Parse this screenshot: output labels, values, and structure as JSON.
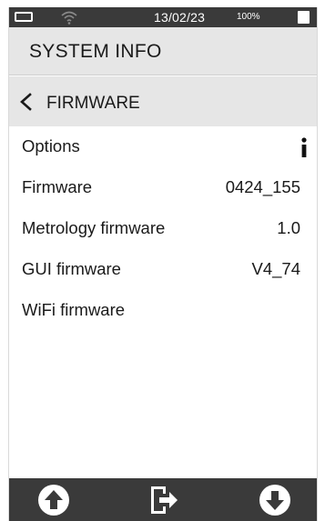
{
  "status_bar": {
    "date": "13/02/23",
    "battery_percent": "100%",
    "icons": [
      "battery-icon",
      "wifi-icon",
      "battery-full-icon"
    ]
  },
  "header": {
    "title": "SYSTEM INFO"
  },
  "subheader": {
    "back_icon": "chevron-left-icon",
    "title": "FIRMWARE"
  },
  "rows": [
    {
      "label": "Options",
      "value": "",
      "icon": "info-icon"
    },
    {
      "label": "Firmware",
      "value": "0424_155"
    },
    {
      "label": "Metrology firmware",
      "value": "1.0"
    },
    {
      "label": "GUI firmware",
      "value": "V4_74"
    },
    {
      "label": "WiFi firmware",
      "value": ""
    }
  ],
  "bottom_bar": {
    "buttons": [
      "arrow-up-circle-icon",
      "exit-icon",
      "arrow-down-circle-icon"
    ]
  },
  "colors": {
    "bar_background": "#3a3a3a",
    "header_background": "#e6e6e6",
    "text": "#1a1a1a",
    "icon_fill": "#ffffff"
  }
}
